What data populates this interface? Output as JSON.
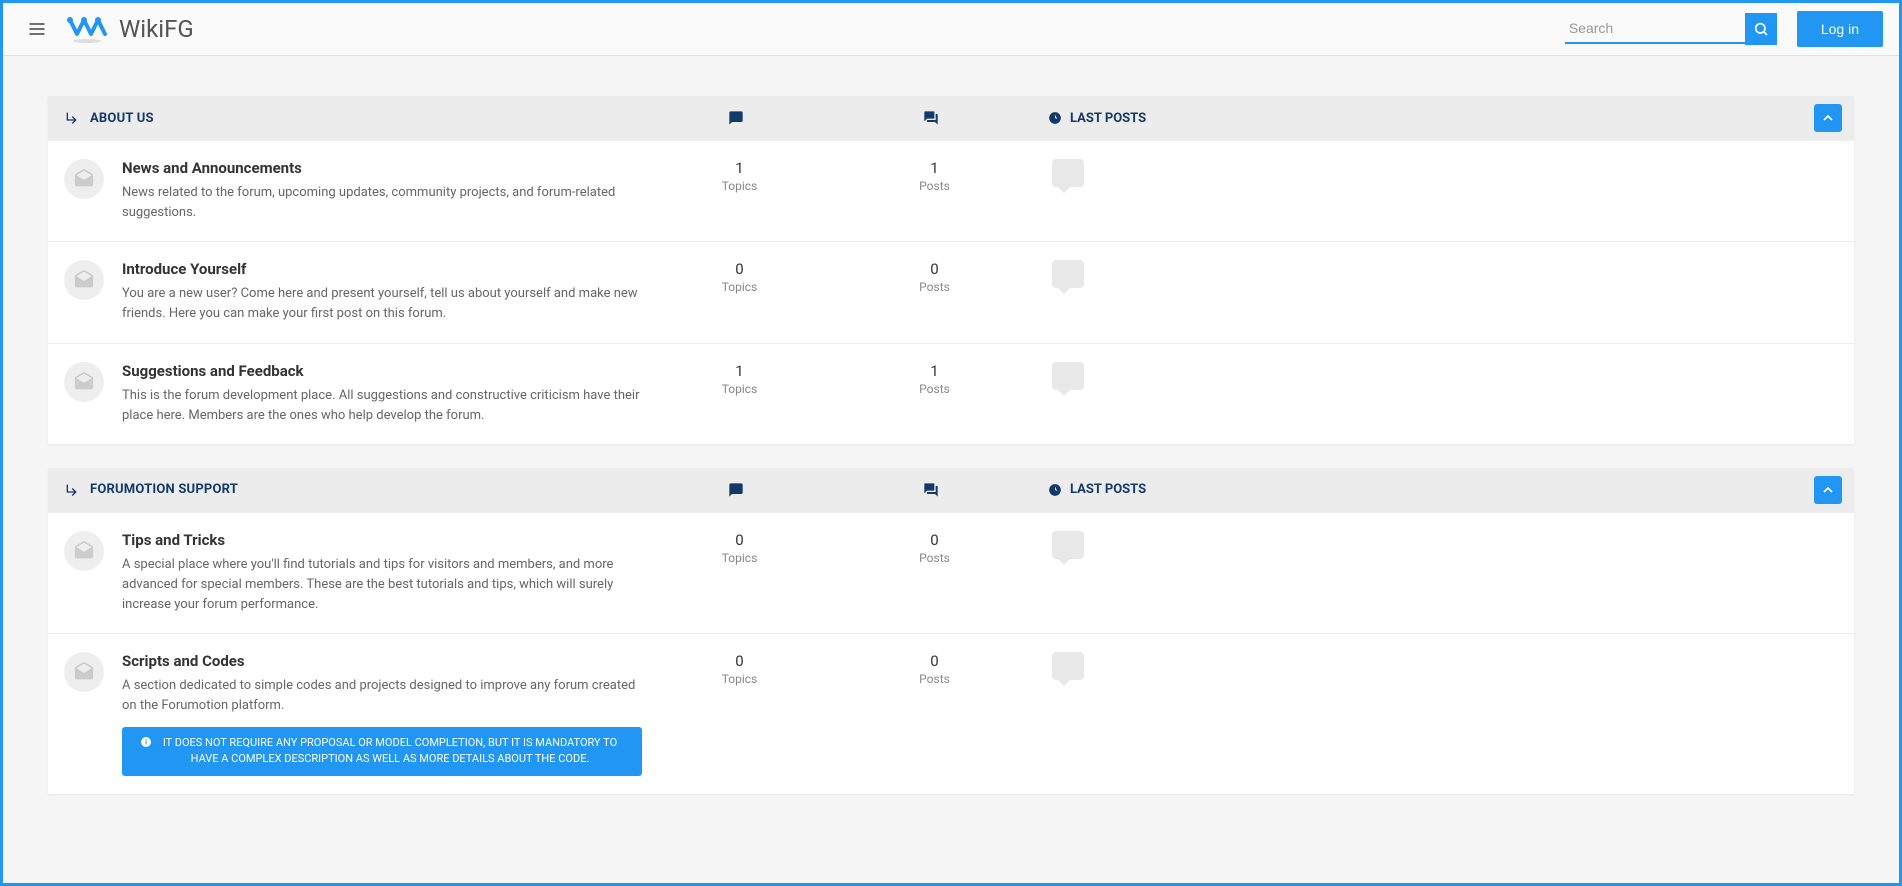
{
  "header": {
    "site_title": "WikiFG",
    "search_placeholder": "Search",
    "login_label": "Log in"
  },
  "last_posts_label": "LAST POSTS",
  "categories": [
    {
      "title": "ABOUT US",
      "forums": [
        {
          "title": "News and Announcements",
          "desc": "News related to the forum, upcoming updates, community projects, and forum-related suggestions.",
          "topics": "1",
          "topics_label": "Topics",
          "posts": "1",
          "posts_label": "Posts",
          "notice": null
        },
        {
          "title": "Introduce Yourself",
          "desc": "You are a new user? Come here and present yourself, tell us about yourself and make new friends. Here you can make your first post on this forum.",
          "topics": "0",
          "topics_label": "Topics",
          "posts": "0",
          "posts_label": "Posts",
          "notice": null
        },
        {
          "title": "Suggestions and Feedback",
          "desc": "This is the forum development place. All suggestions and constructive criticism have their place here. Members are the ones who help develop the forum.",
          "topics": "1",
          "topics_label": "Topics",
          "posts": "1",
          "posts_label": "Posts",
          "notice": null
        }
      ]
    },
    {
      "title": "FORUMOTION SUPPORT",
      "forums": [
        {
          "title": "Tips and Tricks",
          "desc": "A special place where you'll find tutorials and tips for visitors and members, and more advanced for special members. These are the best tutorials and tips, which will surely increase your forum performance.",
          "topics": "0",
          "topics_label": "Topics",
          "posts": "0",
          "posts_label": "Posts",
          "notice": null
        },
        {
          "title": "Scripts and Codes",
          "desc": "A section dedicated to simple codes and projects designed to improve any forum created on the Forumotion platform.",
          "topics": "0",
          "topics_label": "Topics",
          "posts": "0",
          "posts_label": "Posts",
          "notice": "IT DOES NOT REQUIRE ANY PROPOSAL OR MODEL COMPLETION, BUT IT IS MANDATORY TO HAVE A COMPLEX DESCRIPTION AS WELL AS MORE DETAILS ABOUT THE CODE."
        }
      ]
    }
  ]
}
